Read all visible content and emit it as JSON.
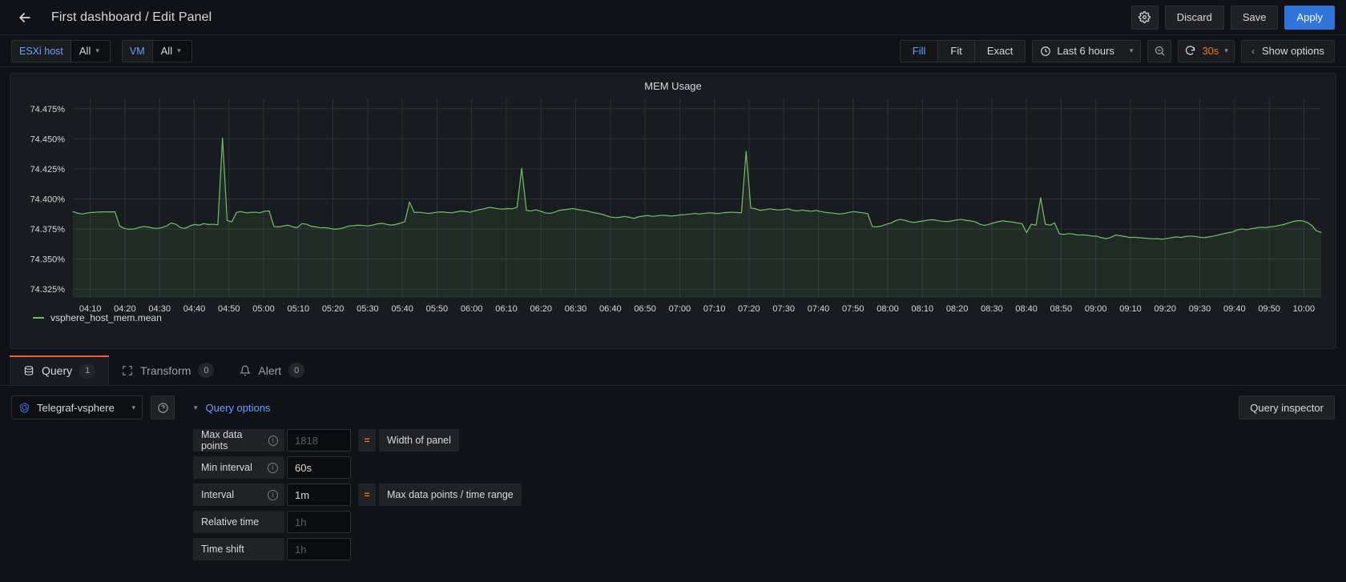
{
  "header": {
    "back_icon": "arrow-left-icon",
    "title": "First dashboard / Edit Panel",
    "settings_icon": "gear-icon",
    "discard_label": "Discard",
    "save_label": "Save",
    "apply_label": "Apply",
    "apply_color": "#3274d9"
  },
  "toolbar": {
    "variables": [
      {
        "label": "ESXi host",
        "value": "All"
      },
      {
        "label": "VM",
        "value": "All"
      }
    ],
    "segments": [
      {
        "label": "Fill",
        "active": true
      },
      {
        "label": "Fit",
        "active": false
      },
      {
        "label": "Exact",
        "active": false
      }
    ],
    "time_range": "Last 6 hours",
    "clock_icon": "clock-icon",
    "zoom_out_icon": "zoom-out-icon",
    "refresh_icon": "refresh-icon",
    "refresh_interval": "30s",
    "refresh_color": "#eb7b18",
    "show_options_label": "Show options",
    "show_options_icon": "chevron-left-icon"
  },
  "panel": {
    "title": "MEM Usage",
    "legend_series": "vsphere_host_mem.mean",
    "series_color": "#73bf69"
  },
  "chart_data": {
    "type": "line",
    "title": "MEM Usage",
    "xlabel": "",
    "ylabel": "",
    "unit": "%",
    "grid": true,
    "legend_position": "bottom-left",
    "series": [
      {
        "name": "vsphere_host_mem.mean",
        "color": "#73bf69",
        "fill": true,
        "values": [
          74.3895,
          74.3882,
          74.3875,
          74.3883,
          74.3888,
          74.389,
          74.3892,
          74.3893,
          74.3893,
          74.3893,
          74.3775,
          74.3755,
          74.3748,
          74.375,
          74.3762,
          74.377,
          74.3768,
          74.3758,
          74.3755,
          74.3762,
          74.3775,
          74.38,
          74.379,
          74.3762,
          74.3755,
          74.3775,
          74.3788,
          74.3782,
          74.3795,
          74.3788,
          74.379,
          74.3785,
          74.4505,
          74.382,
          74.381,
          74.3888,
          74.3895,
          74.3885,
          74.3888,
          74.389,
          74.3885,
          74.3898,
          74.39,
          74.377,
          74.3768,
          74.3775,
          74.3782,
          74.3768,
          74.3762,
          74.3795,
          74.379,
          74.3772,
          74.3768,
          74.376,
          74.3762,
          74.3755,
          74.3748,
          74.3752,
          74.3762,
          74.3775,
          74.3778,
          74.3782,
          74.378,
          74.3775,
          74.3782,
          74.3792,
          74.3798,
          74.379,
          74.3782,
          74.3788,
          74.3798,
          74.3812,
          74.3975,
          74.3888,
          74.389,
          74.3885,
          74.388,
          74.3885,
          74.389,
          74.3892,
          74.3888,
          74.3885,
          74.3892,
          74.39,
          74.3895,
          74.389,
          74.3902,
          74.3912,
          74.3918,
          74.393,
          74.3925,
          74.3918,
          74.3915,
          74.392,
          74.3918,
          74.393,
          74.4255,
          74.3905,
          74.39,
          74.391,
          74.3898,
          74.3885,
          74.388,
          74.389,
          74.3905,
          74.391,
          74.3915,
          74.392,
          74.3912,
          74.3905,
          74.39,
          74.389,
          74.3882,
          74.3875,
          74.3862,
          74.385,
          74.3845,
          74.3848,
          74.3855,
          74.3848,
          74.3838,
          74.3852,
          74.3858,
          74.3862,
          74.3855,
          74.386,
          74.3865,
          74.3862,
          74.3858,
          74.3862,
          74.3868,
          74.387,
          74.3875,
          74.388,
          74.3875,
          74.388,
          74.3885,
          74.3882,
          74.3878,
          74.3885,
          74.3888,
          74.389,
          74.3888,
          74.3885,
          74.4395,
          74.3925,
          74.3918,
          74.3905,
          74.391,
          74.3918,
          74.3912,
          74.3908,
          74.3912,
          74.3918,
          74.3905,
          74.39,
          74.3908,
          74.3902,
          74.3898,
          74.3905,
          74.3895,
          74.3888,
          74.3885,
          74.388,
          74.3875,
          74.388,
          74.3888,
          74.3895,
          74.389,
          74.3885,
          74.3878,
          74.377,
          74.3768,
          74.3775,
          74.379,
          74.38,
          74.382,
          74.383,
          74.3822,
          74.381,
          74.3805,
          74.3812,
          74.3818,
          74.3825,
          74.3828,
          74.382,
          74.3815,
          74.3812,
          74.3818,
          74.3825,
          74.383,
          74.3822,
          74.3818,
          74.381,
          74.379,
          74.378,
          74.379,
          74.3802,
          74.3812,
          74.3818,
          74.3812,
          74.3808,
          74.38,
          74.3795,
          74.372,
          74.379,
          74.3782,
          74.401,
          74.379,
          74.3782,
          74.38,
          74.371,
          74.3705,
          74.3712,
          74.3708,
          74.37,
          74.3702,
          74.3698,
          74.3692,
          74.369,
          74.3678,
          74.367,
          74.368,
          74.37,
          74.3695,
          74.3688,
          74.368,
          74.3682,
          74.3678,
          74.3675,
          74.3672,
          74.3668,
          74.367,
          74.3665,
          74.3672,
          74.3678,
          74.3685,
          74.368,
          74.3688,
          74.3692,
          74.3688,
          74.3682,
          74.3678,
          74.3685,
          74.3692,
          74.37,
          74.371,
          74.3718,
          74.3725,
          74.3742,
          74.375,
          74.3745,
          74.3752,
          74.3758,
          74.3765,
          74.3762,
          74.3768,
          74.3772,
          74.378,
          74.3788,
          74.38,
          74.3812,
          74.382,
          74.3818,
          74.3805,
          74.378,
          74.3735,
          74.3722
        ]
      }
    ],
    "y_ticks": [
      "74.325%",
      "74.350%",
      "74.375%",
      "74.400%",
      "74.425%",
      "74.450%",
      "74.475%"
    ],
    "ylim": [
      74.3185,
      74.4835
    ],
    "x_ticks": [
      "04:10",
      "04:20",
      "04:30",
      "04:40",
      "04:50",
      "05:00",
      "05:10",
      "05:20",
      "05:30",
      "05:40",
      "05:50",
      "06:00",
      "06:10",
      "06:20",
      "06:30",
      "06:40",
      "06:50",
      "07:00",
      "07:10",
      "07:20",
      "07:30",
      "07:40",
      "07:50",
      "08:00",
      "08:10",
      "08:20",
      "08:30",
      "08:40",
      "08:50",
      "09:00",
      "09:10",
      "09:20",
      "09:30",
      "09:40",
      "09:50",
      "10:00"
    ]
  },
  "tabs": [
    {
      "label": "Query",
      "badge": "1",
      "icon": "database-icon",
      "active": true
    },
    {
      "label": "Transform",
      "badge": "0",
      "icon": "transform-icon",
      "active": false
    },
    {
      "label": "Alert",
      "badge": "0",
      "icon": "bell-icon",
      "active": false
    }
  ],
  "query_editor": {
    "datasource": "Telegraf-vsphere",
    "datasource_icon": "influxdb-icon",
    "help_icon": "question-circle-icon",
    "query_options_label": "Query options",
    "query_options_caret": "chevron-down-icon",
    "query_inspector_label": "Query inspector",
    "options": [
      {
        "label": "Max data points",
        "info": true,
        "value": "",
        "placeholder": "1818",
        "eq": "=",
        "desc": "Width of panel"
      },
      {
        "label": "Min interval",
        "info": true,
        "value": "60s",
        "placeholder": "",
        "eq": "",
        "desc": ""
      },
      {
        "label": "Interval",
        "info": true,
        "value": "1m",
        "placeholder": "",
        "eq": "=",
        "desc": "Max data points / time range"
      },
      {
        "label": "Relative time",
        "info": false,
        "value": "",
        "placeholder": "1h",
        "eq": "",
        "desc": ""
      },
      {
        "label": "Time shift",
        "info": false,
        "value": "",
        "placeholder": "1h",
        "eq": "",
        "desc": ""
      }
    ]
  }
}
